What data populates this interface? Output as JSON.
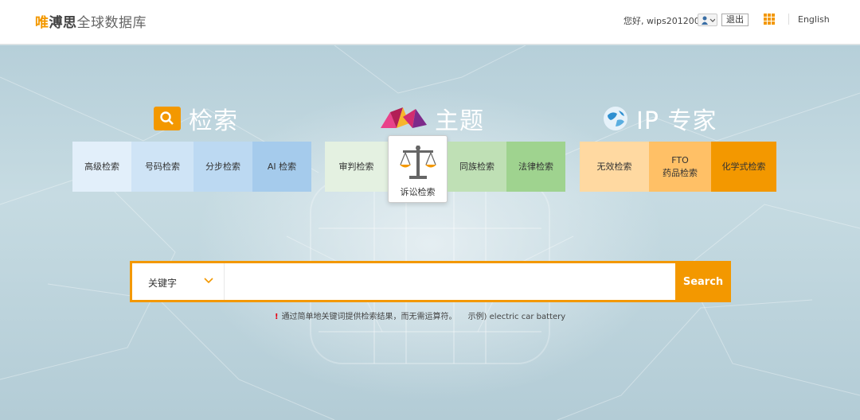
{
  "header": {
    "logo": {
      "part1": "唯",
      "part2": "溥思",
      "part3": "全球数据库"
    },
    "greeting": "您好, wips2012006",
    "logout_label": "退出",
    "language_label": "English",
    "accent_color": "#f39800"
  },
  "groups": {
    "search": {
      "title": "检索",
      "icon": "search-icon",
      "tiles": [
        "高级检索",
        "号码检索",
        "分步检索",
        "AI 检索"
      ]
    },
    "topic": {
      "title": "主题",
      "icon": "topic-logo-icon",
      "tiles": [
        "审判检索",
        "诉讼检索",
        "同族检索",
        "法律检索"
      ]
    },
    "ip": {
      "title": "IP 专家",
      "icon": "globe-icon",
      "tiles": [
        "无效检索",
        "FTO",
        "药品检索",
        "化学式检索"
      ]
    }
  },
  "search": {
    "select_value": "关键字",
    "input_value": "",
    "button_label": "Search",
    "hint_marker": "!",
    "hint_text": "通过简单地关键词提供检索结果，而无需运算符。",
    "hint_example": "示例) electric car battery"
  }
}
